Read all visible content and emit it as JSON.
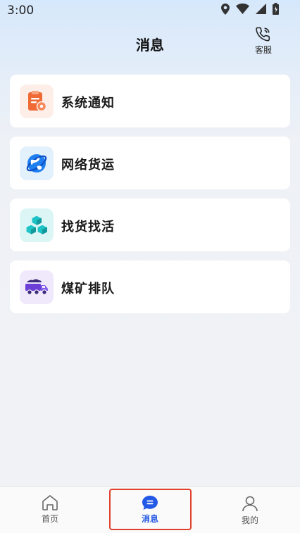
{
  "status_bar": {
    "time": "3:00",
    "icons": [
      "location-icon",
      "wifi-icon",
      "signal-icon",
      "battery-icon"
    ]
  },
  "header": {
    "title": "消息",
    "service_label": "客服",
    "service_icon": "phone-icon"
  },
  "message_categories": [
    {
      "label": "系统通知",
      "icon": "clipboard-gear-icon",
      "icon_color": "#f06a35",
      "bg_color": "#fdeee8"
    },
    {
      "label": "网络货运",
      "icon": "globe-icon",
      "icon_color": "#1f7ef0",
      "bg_color": "#e3f1fc"
    },
    {
      "label": "找货找活",
      "icon": "boxes-icon",
      "icon_color": "#1ec3c6",
      "bg_color": "#dcf6f6"
    },
    {
      "label": "煤矿排队",
      "icon": "truck-icon",
      "icon_color": "#6b3fd6",
      "bg_color": "#efe9fb"
    }
  ],
  "tabbar": {
    "tabs": [
      {
        "label": "首页",
        "icon": "home-icon",
        "active": false
      },
      {
        "label": "消息",
        "icon": "message-icon",
        "active": true
      },
      {
        "label": "我的",
        "icon": "user-icon",
        "active": false
      }
    ]
  },
  "colors": {
    "accent": "#2458e6",
    "highlight": "#e0412f"
  }
}
